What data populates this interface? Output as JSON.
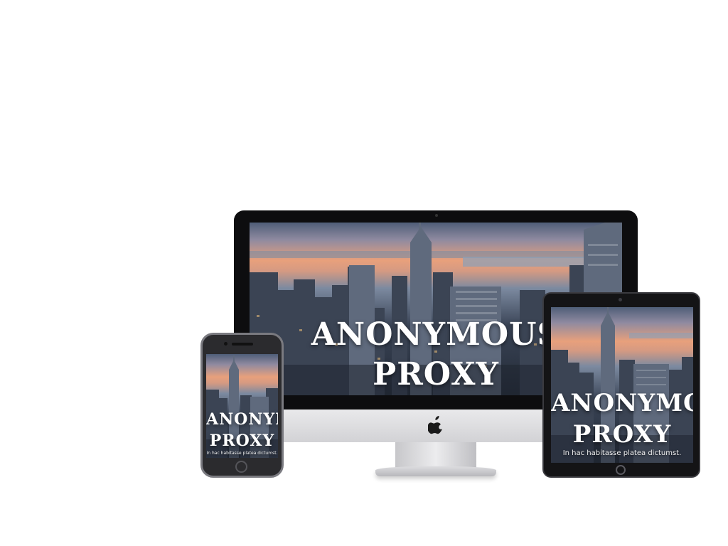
{
  "hero": {
    "title_line1": "ANONYMOUS",
    "title_line2": "PROXY",
    "tagline": "In hac habitasse platea dictumst."
  },
  "colors": {
    "background": "#ffffff",
    "device_dark": "#0d0d0f",
    "device_silver": "#d9d9dc",
    "sky_sunset": "#e8a07c"
  },
  "icons": {
    "brand_logo": "apple-logo-icon"
  }
}
